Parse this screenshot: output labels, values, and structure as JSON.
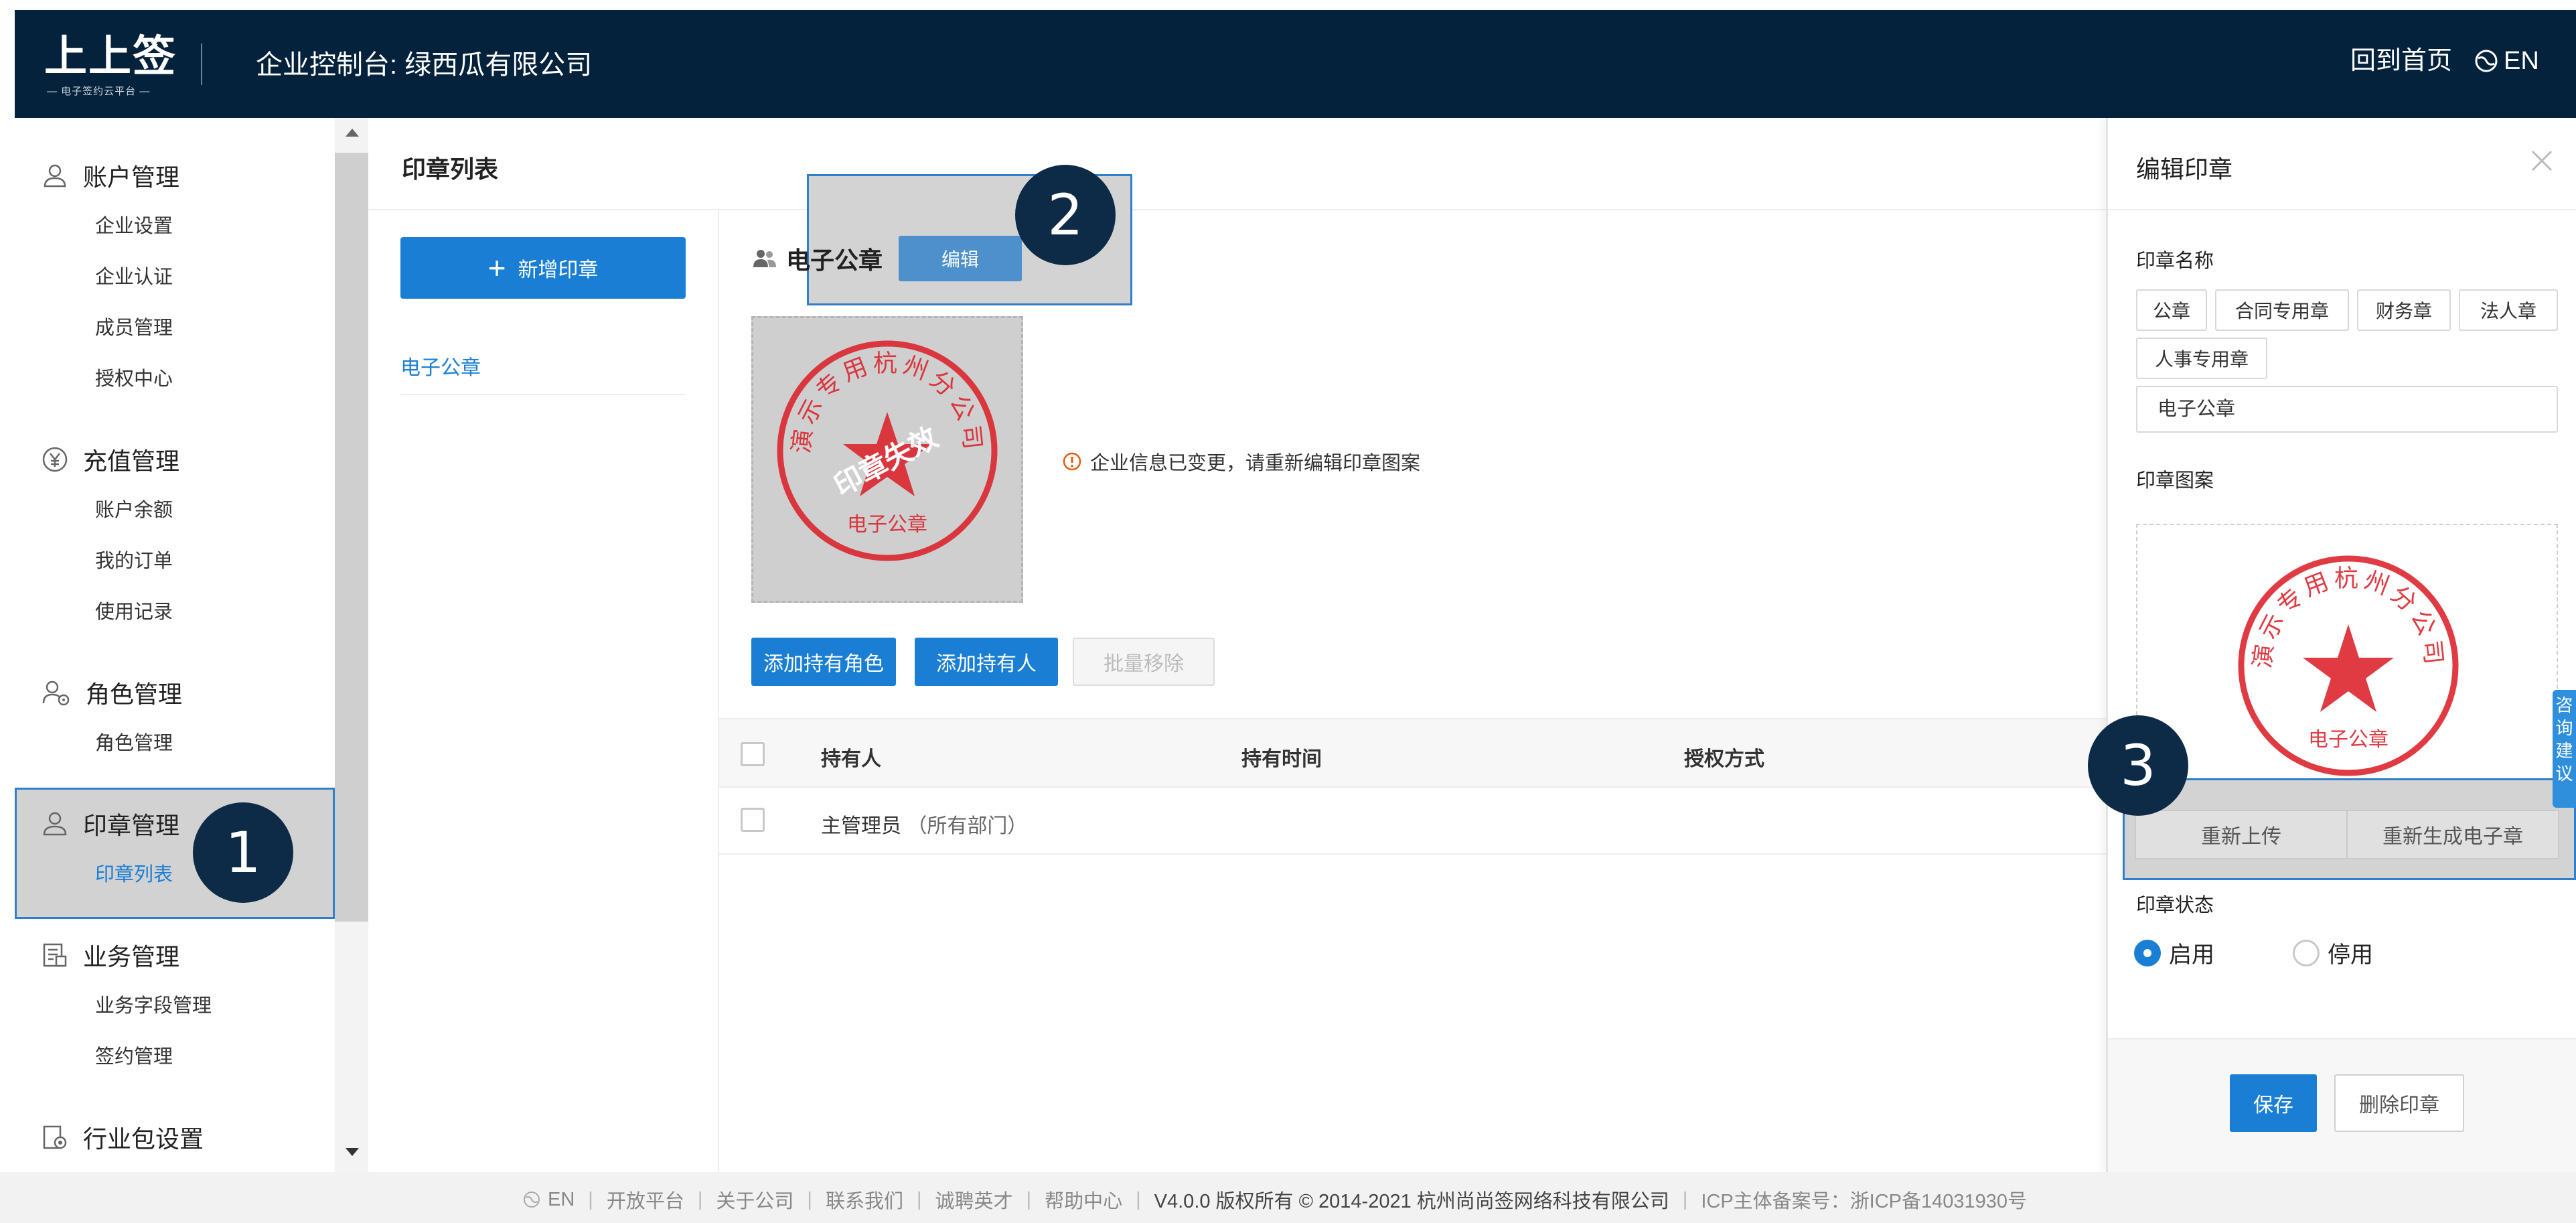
{
  "header": {
    "logo_text": "上上签",
    "logo_subtitle": "— 电子签约云平台 —",
    "title": "企业控制台:  绿西瓜有限公司",
    "home_link": "回到首页",
    "lang_label": "EN",
    "background": "#04223b"
  },
  "sidebar": {
    "groups": [
      {
        "label": "账户管理",
        "icon": "user-icon",
        "items": [
          "企业设置",
          "企业认证",
          "成员管理",
          "授权中心"
        ]
      },
      {
        "label": "充值管理",
        "icon": "yen-icon",
        "items": [
          "账户余额",
          "我的订单",
          "使用记录"
        ]
      },
      {
        "label": "角色管理",
        "icon": "role-icon",
        "items": [
          "角色管理"
        ]
      },
      {
        "label": "印章管理",
        "icon": "seal-user-icon",
        "items": [
          "印章列表"
        ]
      },
      {
        "label": "业务管理",
        "icon": "business-icon",
        "items": [
          "业务字段管理",
          "签约管理"
        ]
      },
      {
        "label": "行业包设置",
        "icon": "package-icon",
        "items": []
      }
    ],
    "active_item": "印章列表"
  },
  "main": {
    "page_title": "印章列表",
    "add_seal_label": "新增印章",
    "seal_list": [
      "电子公章"
    ],
    "seal_name": "电子公章",
    "edit_label": "编辑",
    "seal_image": {
      "arc_text": "演示专用杭州分公司",
      "bottom_text": "电子公章",
      "stamp_overlay": "印章失效",
      "color": "#d9363e"
    },
    "warning_text": "企业信息已变更，请重新编辑印章图案",
    "add_role_label": "添加持有角色",
    "add_holder_label": "添加持有人",
    "batch_remove_label": "批量移除",
    "table": {
      "columns": [
        "持有人",
        "持有时间",
        "授权方式"
      ],
      "rows": [
        {
          "holder": "主管理员",
          "scope": "（所有部门）"
        }
      ]
    }
  },
  "edit_panel": {
    "title": "编辑印章",
    "name_label": "印章名称",
    "name_tags": [
      "公章",
      "合同专用章",
      "财务章",
      "法人章",
      "人事专用章"
    ],
    "name_value": "电子公章",
    "pattern_label": "印章图案",
    "reupload_label": "重新上传",
    "regenerate_label": "重新生成电子章",
    "status_label": "印章状态",
    "status_options": [
      "启用",
      "停用"
    ],
    "status_selected": "启用",
    "save_label": "保存",
    "delete_label": "删除印章",
    "consult_tab": [
      "咨",
      "询",
      "建",
      "议"
    ]
  },
  "callouts": [
    "1",
    "2",
    "3"
  ],
  "footer": {
    "lang": "EN",
    "links": [
      "开放平台",
      "关于公司",
      "联系我们",
      "诚聘英才",
      "帮助中心"
    ],
    "copyright": "V4.0.0 版权所有 © 2014-2021 杭州尚尚签网络科技有限公司",
    "icp": "ICP主体备案号：浙ICP备14031930号"
  },
  "colors": {
    "accent": "#1a7fd4",
    "callout": "#0d2a47",
    "highlight_border": "#2f7fc9",
    "seal_red": "#d9363e"
  }
}
